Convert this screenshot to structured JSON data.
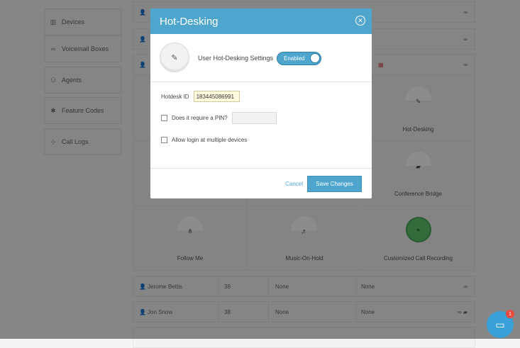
{
  "sidebar": {
    "items": [
      {
        "label": "Devices",
        "icon": "devices-icon",
        "glyph": "▥"
      },
      {
        "label": "Voicemail Boxes",
        "icon": "voicemail-icon",
        "glyph": "∞"
      },
      {
        "label": "Agents",
        "icon": "agents-icon",
        "glyph": "⚇"
      },
      {
        "label": "Feature Codes",
        "icon": "asterisk-icon",
        "glyph": "✱"
      },
      {
        "label": "Call Logs",
        "icon": "call-logs-icon",
        "glyph": "⊹"
      }
    ]
  },
  "features": [
    {
      "label": "Hot-Desking",
      "glyph": "✎"
    },
    {
      "label": "Conference Bridge",
      "glyph": "▰"
    },
    {
      "label": "Follow Me",
      "glyph": "⋔"
    },
    {
      "label": "Music-On-Hold",
      "glyph": "♬"
    },
    {
      "label": "Customized Call Recording",
      "glyph": "●"
    }
  ],
  "users": [
    {
      "name": "Jerome Bettis",
      "ext": "36",
      "col3": "None",
      "col4": "None"
    },
    {
      "name": "Jon Snow",
      "ext": "38",
      "col3": "None",
      "col4": "None"
    }
  ],
  "modal": {
    "title": "Hot-Desking",
    "close_glyph": "✕",
    "avatar_glyph": "✎",
    "setting_label": "User Hot-Desking Settings",
    "toggle_label": "Enabled",
    "hotdesk_label": "Hotdesk ID",
    "hotdesk_value": "183445086991",
    "pin_label": "Does it require a PIN?",
    "pin_value": "",
    "multi_label": "Allow login at multiple devices",
    "cancel_label": "Cancel",
    "save_label": "Save Changes"
  },
  "chat": {
    "badge": "1",
    "glyph": "▭"
  },
  "colors": {
    "accent": "#4ea6cf",
    "recording_green": "#5ec36b",
    "badge_red": "#e84c3d"
  }
}
